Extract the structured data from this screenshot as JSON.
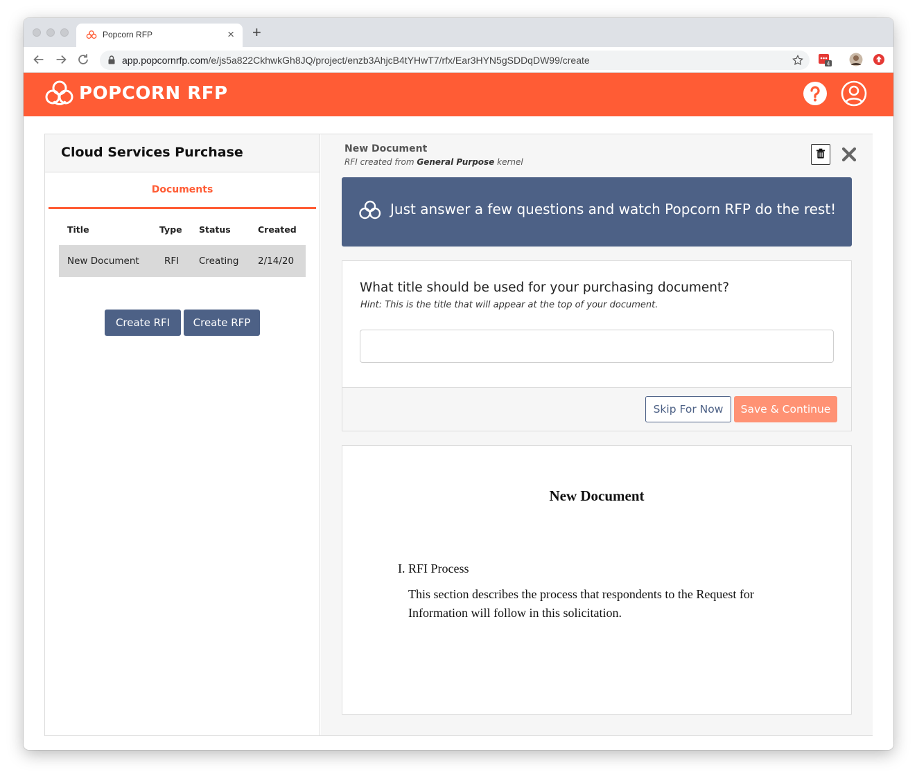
{
  "browser": {
    "tab_title": "Popcorn RFP",
    "tab_close": "×",
    "new_tab": "+",
    "url_host": "app.popcornrfp.com",
    "url_path": "/e/js5a822CkhwkGh8JQ/project/enzb3AhjcB4tYHwT7/rfx/Ear3HYN5gSDDqDW99/create",
    "extension_badge": "4"
  },
  "appbar": {
    "brand": "POPCORN RFP",
    "brand_color": "#ff5c35"
  },
  "sidebar": {
    "project_title": "Cloud Services Purchase",
    "tab_label": "Documents",
    "columns": [
      "Title",
      "Type",
      "Status",
      "Created"
    ],
    "rows": [
      {
        "title": "New Document",
        "type": "RFI",
        "status": "Creating",
        "created": "2/14/20"
      }
    ],
    "create_rfi_label": "Create RFI",
    "create_rfp_label": "Create RFP"
  },
  "editor": {
    "doc_name": "New Document",
    "sub_prefix": "RFI created from ",
    "sub_kernel": "General Purpose",
    "sub_suffix": " kernel",
    "banner_text": "Just answer a few questions and watch Popcorn RFP do the rest!",
    "banner_color": "#4d6186",
    "question": "What title should be used for your purchasing document?",
    "hint": "Hint: This is the title that will appear at the top of your document.",
    "answer_value": "",
    "skip_label": "Skip For Now",
    "save_label": "Save & Continue"
  },
  "preview": {
    "title": "New Document",
    "section_heading": "I. RFI Process",
    "section_body": "This section describes the process that respondents to the Request for Information will follow in this solicitation."
  }
}
